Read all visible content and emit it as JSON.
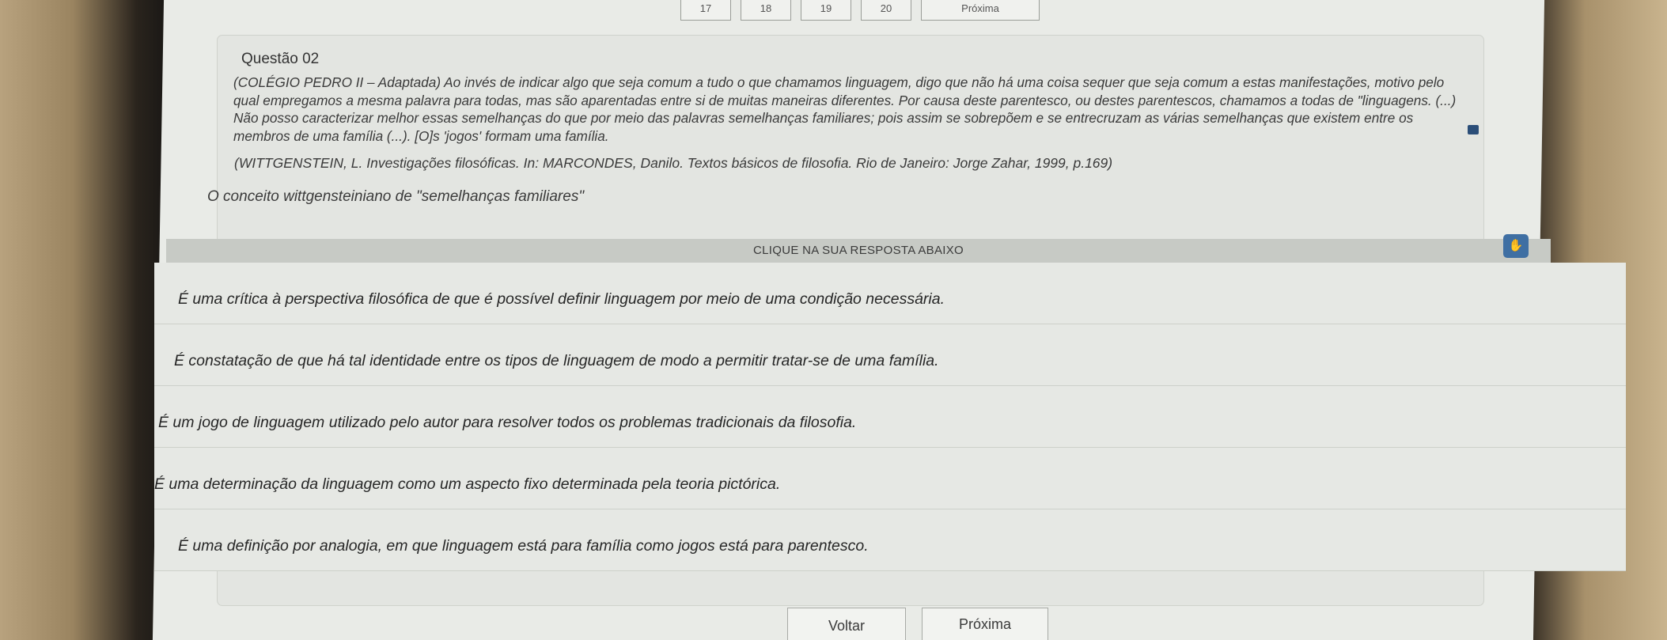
{
  "pager": {
    "pages": [
      "17",
      "18",
      "19",
      "20"
    ],
    "next_label": "Próxima"
  },
  "question": {
    "title": "Questão 02",
    "text": "(COLÉGIO PEDRO II – Adaptada) Ao invés de indicar algo que seja comum a tudo o que chamamos linguagem, digo que não há uma coisa sequer que seja comum a estas manifestações, motivo pelo qual empregamos a mesma palavra para todas, mas são aparentadas entre si de muitas maneiras diferentes. Por causa deste parentesco, ou destes parentescos, chamamos a todas de \"linguagens. (...) Não posso caracterizar melhor essas semelhanças do que por meio das palavras semelhanças familiares; pois assim se sobrepõem e se entrecruzam as várias semelhanças que existem entre os membros de uma família (...). [O]s 'jogos' formam uma família.",
    "citation": "(WITTGENSTEIN, L. Investigações filosóficas. In: MARCONDES, Danilo. Textos básicos de filosofia. Rio de Janeiro: Jorge Zahar, 1999, p.169)",
    "prompt": "O conceito wittgensteiniano de \"semelhanças familiares\""
  },
  "instruction": "CLIQUE NA SUA RESPOSTA ABAIXO",
  "options": [
    "É uma crítica à perspectiva filosófica de que é possível definir linguagem por meio de uma condição necessária.",
    "É constatação de que há tal identidade entre os tipos de linguagem de modo a permitir tratar-se de uma família.",
    "É um jogo de linguagem utilizado pelo autor para resolver todos os problemas tradicionais da filosofia.",
    "É uma determinação da linguagem como um aspecto fixo determinada pela teoria pictórica.",
    "É uma definição por analogia, em que linguagem está para família como jogos está para parentesco."
  ],
  "nav": {
    "back_label": "Voltar",
    "next_label": "Próxima"
  }
}
